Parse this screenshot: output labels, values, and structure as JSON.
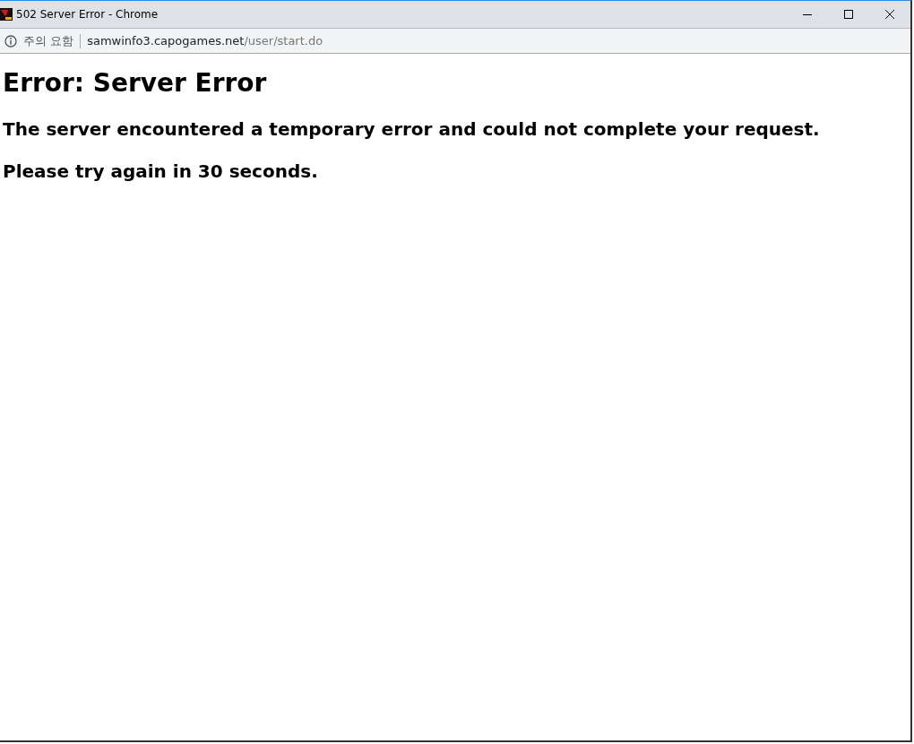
{
  "window": {
    "title": "502 Server Error - Chrome"
  },
  "address_bar": {
    "security_label": "주의 요함",
    "host": "samwinfo3.capogames.net",
    "path": "/user/start.do"
  },
  "page": {
    "heading": "Error: Server Error",
    "message": "The server encountered a temporary error and could not complete your request.",
    "retry": "Please try again in 30 seconds."
  }
}
